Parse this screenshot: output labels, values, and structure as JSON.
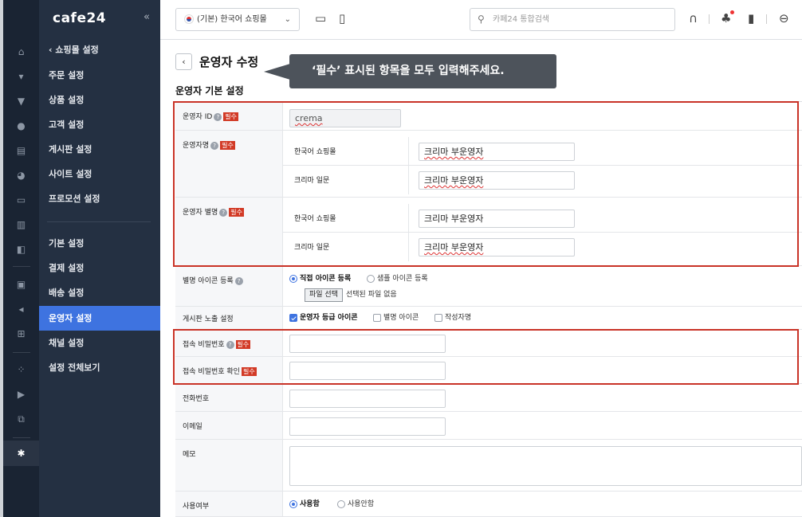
{
  "brand": {
    "logo": "cafe24",
    "collapse_icon": "«"
  },
  "sidebar": {
    "back_label": "‹ 쇼핑몰 설정",
    "items": [
      {
        "label": "주문 설정"
      },
      {
        "label": "상품 설정"
      },
      {
        "label": "고객 설정"
      },
      {
        "label": "게시판 설정"
      },
      {
        "label": "사이트 설정"
      },
      {
        "label": "프로모션 설정"
      },
      {
        "label": "기본 설정"
      },
      {
        "label": "결제 설정"
      },
      {
        "label": "배송 설정"
      },
      {
        "label": "운영자 설정",
        "active": true
      },
      {
        "label": "채널 설정"
      },
      {
        "label": "설정 전체보기"
      }
    ],
    "rail_icons": [
      "home-icon",
      "cart-icon",
      "shirt-icon",
      "user-icon",
      "board-icon",
      "palette-icon",
      "promo-icon",
      "stats-icon",
      "app-icon",
      "store-icon",
      "megaphone-icon",
      "plus-store-icon",
      "grid-add-icon",
      "folder-play-icon",
      "copy-icon",
      "gear-icon"
    ]
  },
  "header": {
    "store_select": "(기본) 한국어 쇼핑몰",
    "search_placeholder": "카페24 통합검색",
    "icons": [
      "desktop-icon",
      "mobile-icon",
      "headset-icon",
      "bell-icon",
      "bookmark-icon",
      "account-icon"
    ]
  },
  "page": {
    "back_icon": "‹",
    "title": "운영자 수정",
    "tooltip": "‘필수’ 표시된 항목을 모두 입력해주세요.",
    "section_title": "운영자 기본 설정",
    "required_badge": "필수",
    "help_glyph": "?"
  },
  "form": {
    "operator_id": {
      "label": "운영자 ID",
      "value": "crema"
    },
    "operator_name": {
      "label": "운영자명",
      "rows": [
        {
          "label": "한국어 쇼핑몰",
          "value": "크리마 부운영자"
        },
        {
          "label": "크리마 일문",
          "value": "크리마 부운영자"
        }
      ]
    },
    "operator_alias": {
      "label": "운영자 별명",
      "rows": [
        {
          "label": "한국어 쇼핑몰",
          "value": "크리마 부운영자"
        },
        {
          "label": "크리마 일문",
          "value": "크리마 부운영자"
        }
      ]
    },
    "alias_icon": {
      "label": "별명 아이콘 등록",
      "options": [
        "직접 아이콘 등록",
        "샘플 아이콘 등록"
      ],
      "selected": "직접 아이콘 등록",
      "file_button": "파일 선택",
      "file_status": "선택된 파일 없음"
    },
    "board_display": {
      "label": "게시판 노출 설정",
      "options": [
        {
          "label": "운영자 등급 아이콘",
          "checked": true
        },
        {
          "label": "별명 아이콘",
          "checked": false
        },
        {
          "label": "작성자명",
          "checked": false
        }
      ]
    },
    "password": {
      "label": "접속 비밀번호",
      "value": ""
    },
    "password_confirm": {
      "label": "접속 비밀번호 확인",
      "value": ""
    },
    "phone": {
      "label": "전화번호",
      "value": ""
    },
    "email": {
      "label": "이메일",
      "value": ""
    },
    "memo": {
      "label": "메모",
      "value": ""
    },
    "usage": {
      "label": "사용여부",
      "options": [
        "사용함",
        "사용안함"
      ],
      "selected": "사용함"
    }
  },
  "colors": {
    "accent": "#3e73e0",
    "required": "#d23a26",
    "highlight_box": "#c93327",
    "sidebar": "#243042",
    "rail": "#1a2433"
  }
}
